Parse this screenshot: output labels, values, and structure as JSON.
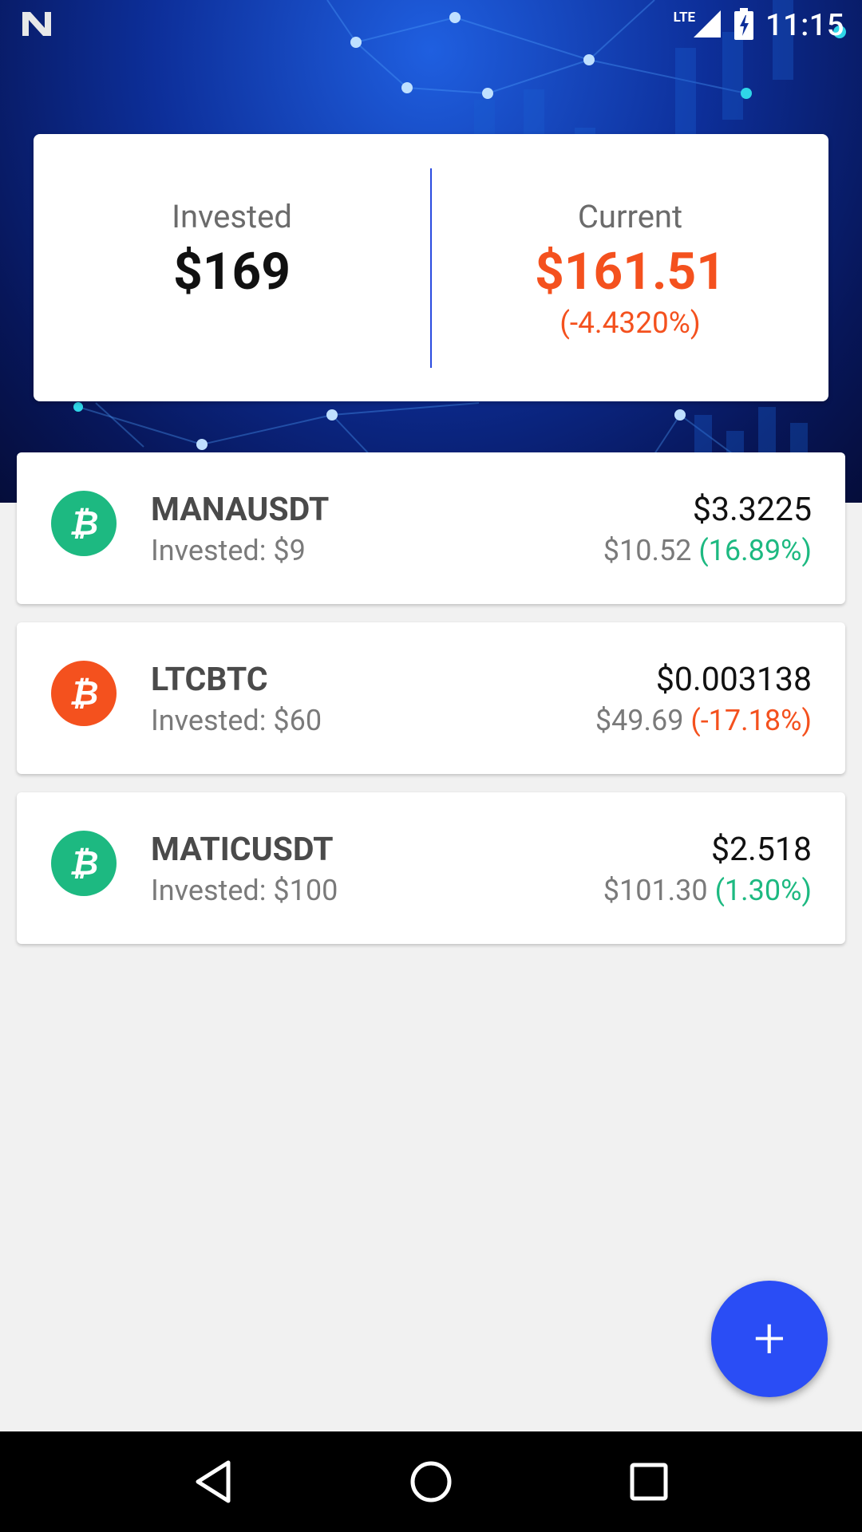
{
  "status_bar": {
    "time": "11:15",
    "network": "LTE",
    "icons": [
      "notification-n-icon",
      "signal-icon",
      "battery-charging-icon"
    ]
  },
  "summary": {
    "invested_label": "Invested",
    "invested_value": "$169",
    "current_label": "Current",
    "current_value": "$161.51",
    "current_change": "(-4.4320%)",
    "current_color": "#f4511e"
  },
  "assets": [
    {
      "name": "MANAUSDT",
      "invested": "Invested: $9",
      "price": "$3.3225",
      "value": "$10.52",
      "change": "(16.89%)",
      "icon": "bitcoin-icon",
      "icon_color": "#1db981",
      "change_color": "#1db981"
    },
    {
      "name": "LTCBTC",
      "invested": "Invested: $60",
      "price": "$0.003138",
      "value": "$49.69",
      "change": "(-17.18%)",
      "icon": "bitcoin-icon",
      "icon_color": "#f4511e",
      "change_color": "#f4511e"
    },
    {
      "name": "MATICUSDT",
      "invested": "Invested: $100",
      "price": "$2.518",
      "value": "$101.30",
      "change": "(1.30%)",
      "icon": "bitcoin-icon",
      "icon_color": "#1db981",
      "change_color": "#1db981"
    }
  ],
  "fab": {
    "label": "+",
    "icon": "plus-icon",
    "color": "#2a4df5"
  },
  "nav_bar": {
    "icons": [
      "back-icon",
      "home-icon",
      "recents-icon"
    ]
  }
}
